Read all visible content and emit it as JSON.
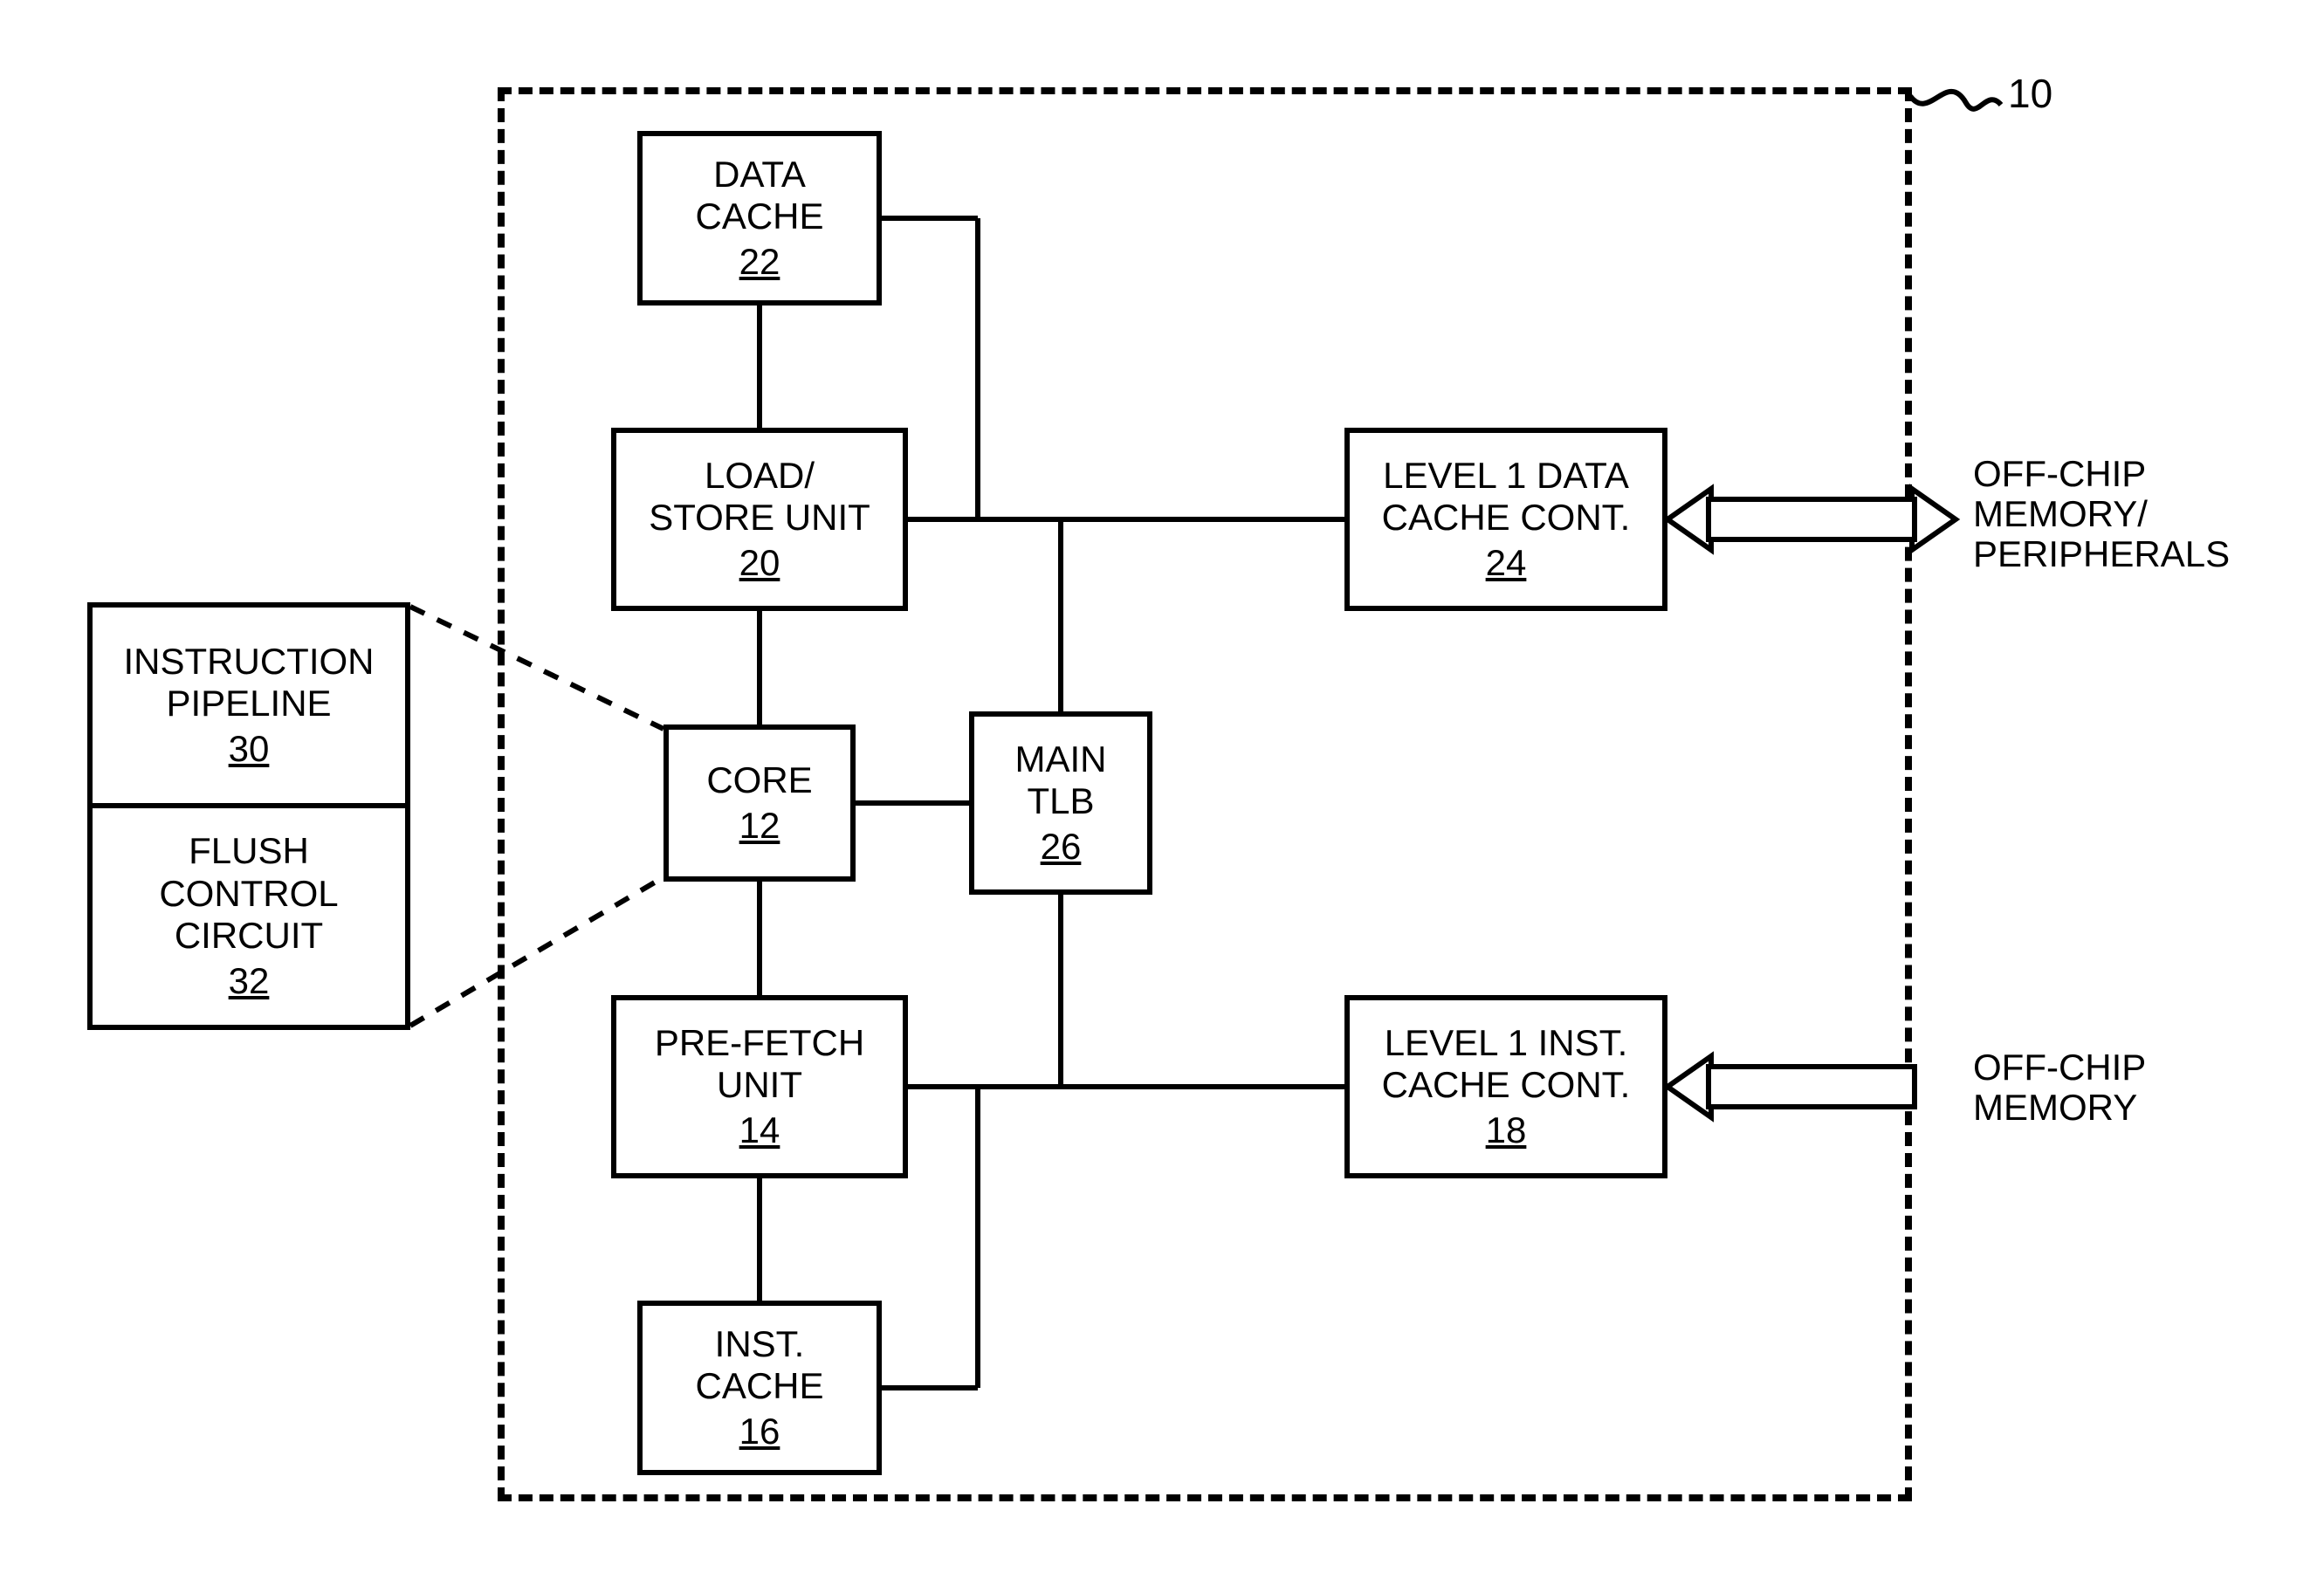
{
  "chip_ref": "10",
  "off_chip_top": {
    "l1": "OFF-CHIP",
    "l2": "MEMORY/",
    "l3": "PERIPHERALS"
  },
  "off_chip_bottom": {
    "l1": "OFF-CHIP",
    "l2": "MEMORY"
  },
  "blocks": {
    "data_cache": {
      "l1": "DATA",
      "l2": "CACHE",
      "ref": "22"
    },
    "lsu": {
      "l1": "LOAD/",
      "l2": "STORE UNIT",
      "ref": "20"
    },
    "core": {
      "l1": "CORE",
      "ref": "12"
    },
    "tlb": {
      "l1": "MAIN",
      "l2": "TLB",
      "ref": "26"
    },
    "prefetch": {
      "l1": "PRE-FETCH",
      "l2": "UNIT",
      "ref": "14"
    },
    "icache": {
      "l1": "INST.",
      "l2": "CACHE",
      "ref": "16"
    },
    "l1d": {
      "l1": "LEVEL 1 DATA",
      "l2": "CACHE CONT.",
      "ref": "24"
    },
    "l1i": {
      "l1": "LEVEL 1 INST.",
      "l2": "CACHE CONT.",
      "ref": "18"
    },
    "pipe": {
      "l1": "INSTRUCTION",
      "l2": "PIPELINE",
      "ref": "30"
    },
    "flush": {
      "l1": "FLUSH",
      "l2": "CONTROL",
      "l3": "CIRCUIT",
      "ref": "32"
    }
  }
}
